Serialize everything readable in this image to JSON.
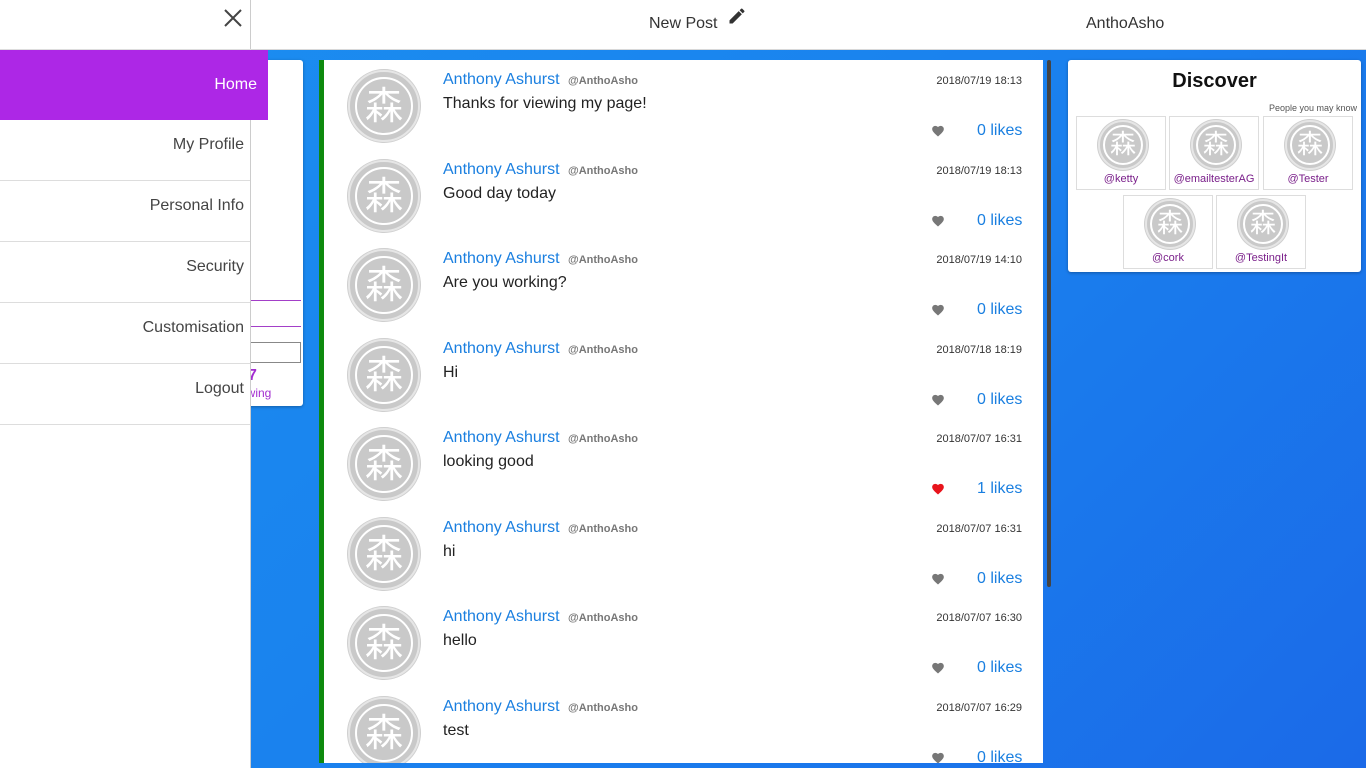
{
  "topbar": {
    "new_post": "New Post",
    "username": "AnthoAsho"
  },
  "drawer": {
    "items": [
      {
        "label": "Home",
        "active": true
      },
      {
        "label": "My Profile"
      },
      {
        "label": "Personal Info"
      },
      {
        "label": "Security"
      },
      {
        "label": "Customisation"
      },
      {
        "label": "Logout"
      }
    ]
  },
  "profile_card": {
    "count_partial": "7",
    "following_partial": "owing"
  },
  "feed": {
    "posts": [
      {
        "author": "Anthony Ashurst",
        "handle": "@AnthoAsho",
        "date": "2018/07/19 18:13",
        "text": "Thanks for viewing my page!",
        "likes": "0 likes",
        "liked": false
      },
      {
        "author": "Anthony Ashurst",
        "handle": "@AnthoAsho",
        "date": "2018/07/19 18:13",
        "text": "Good day today",
        "likes": "0 likes",
        "liked": false
      },
      {
        "author": "Anthony Ashurst",
        "handle": "@AnthoAsho",
        "date": "2018/07/19 14:10",
        "text": "Are you working?",
        "likes": "0 likes",
        "liked": false
      },
      {
        "author": "Anthony Ashurst",
        "handle": "@AnthoAsho",
        "date": "2018/07/18 18:19",
        "text": "Hi",
        "likes": "0 likes",
        "liked": false
      },
      {
        "author": "Anthony Ashurst",
        "handle": "@AnthoAsho",
        "date": "2018/07/07 16:31",
        "text": "looking good",
        "likes": "1 likes",
        "liked": true
      },
      {
        "author": "Anthony Ashurst",
        "handle": "@AnthoAsho",
        "date": "2018/07/07 16:31",
        "text": "hi",
        "likes": "0 likes",
        "liked": false
      },
      {
        "author": "Anthony Ashurst",
        "handle": "@AnthoAsho",
        "date": "2018/07/07 16:30",
        "text": "hello",
        "likes": "0 likes",
        "liked": false
      },
      {
        "author": "Anthony Ashurst",
        "handle": "@AnthoAsho",
        "date": "2018/07/07 16:29",
        "text": "test",
        "likes": "0 likes",
        "liked": false
      }
    ]
  },
  "discover": {
    "title": "Discover",
    "subtitle": "People you may know",
    "people": [
      "@ketty",
      "@emailtesterAG",
      "@Tester",
      "@cork",
      "@TestingIt"
    ]
  },
  "avatar_glyph": "森",
  "colors": {
    "accent_purple": "#ad27e6",
    "link_blue": "#1a7fe0",
    "feed_border_green": "#0e8a0e",
    "liked_heart": "#e8141c",
    "unliked_heart": "#777777"
  },
  "icons": {
    "close": "close-icon",
    "edit": "pencil-icon",
    "like": "heart-icon"
  }
}
